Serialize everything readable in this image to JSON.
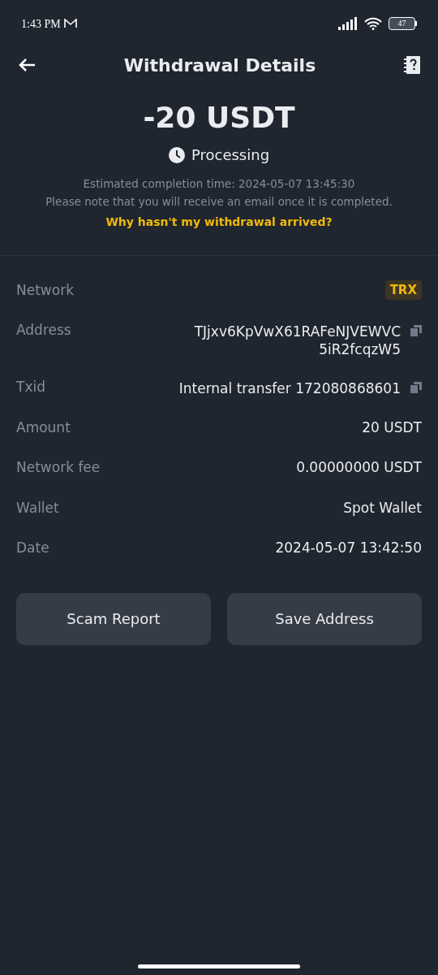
{
  "status_bar": {
    "time": "1:43 PM",
    "battery": "47"
  },
  "header": {
    "title": "Withdrawal Details"
  },
  "summary": {
    "amount": "-20 USDT",
    "status": "Processing",
    "estimate": "Estimated completion time: 2024-05-07 13:45:30",
    "note": "Please note that you will receive an email once it is completed.",
    "help_link": "Why hasn't my withdrawal arrived?"
  },
  "details": [
    {
      "kind": "badge",
      "label": "Network",
      "value_lines": [
        "TRX"
      ]
    },
    {
      "kind": "copy",
      "label": "Address",
      "value_lines": [
        "TJjxv6KpVwX61RAFeNJVEWVC",
        "5iR2fcqzW5"
      ]
    },
    {
      "kind": "copy",
      "label": "Txid",
      "value_lines": [
        "Internal transfer 172080868601"
      ]
    },
    {
      "kind": "text",
      "label": "Amount",
      "value_lines": [
        "20 USDT"
      ]
    },
    {
      "kind": "text",
      "label": "Network fee",
      "value_lines": [
        "0.00000000 USDT"
      ]
    },
    {
      "kind": "text",
      "label": "Wallet",
      "value_lines": [
        "Spot Wallet"
      ]
    },
    {
      "kind": "text",
      "label": "Date",
      "value_lines": [
        "2024-05-07 13:42:50"
      ]
    }
  ],
  "buttons": [
    "Scam Report",
    "Save Address"
  ]
}
